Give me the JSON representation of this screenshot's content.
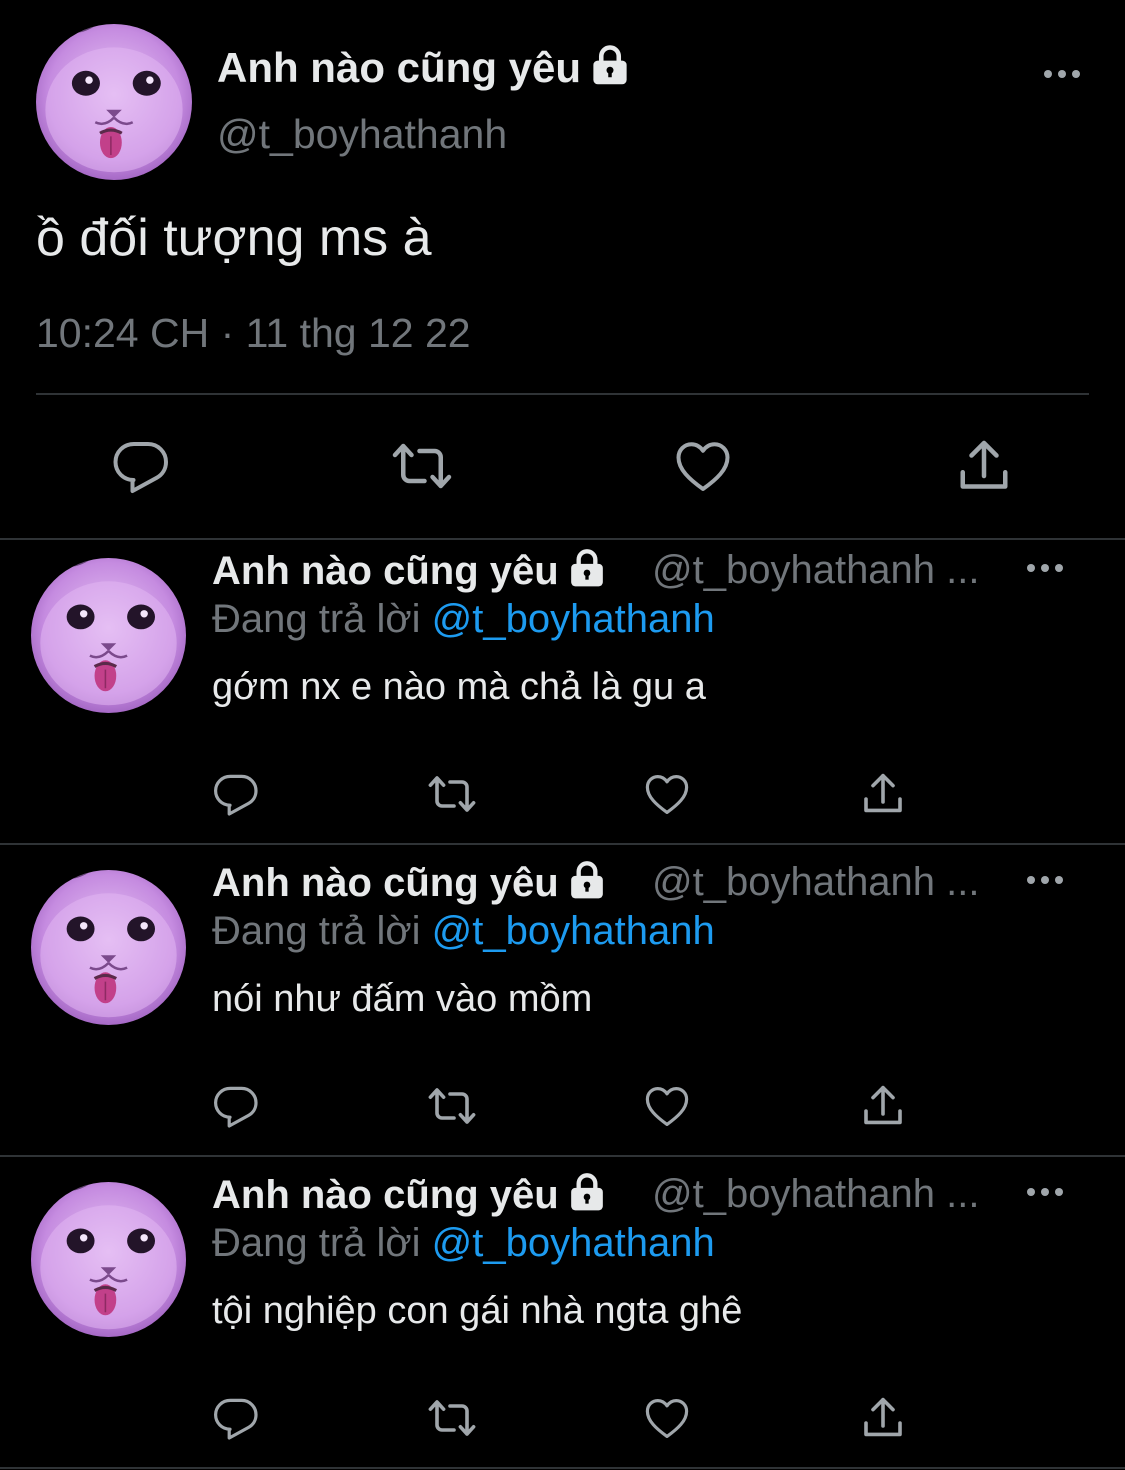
{
  "main_tweet": {
    "display_name": "Anh nào cũng yêu",
    "handle": "@t_boyhathanh",
    "text": "ồ đối tượng ms à",
    "timestamp": "10:24 CH · 11 thg 12 22"
  },
  "replies": [
    {
      "display_name": "Anh nào cũng yêu",
      "handle": "@t_boyhathanh ...",
      "replying_prefix": "Đang trả lời ",
      "replying_to": "@t_boyhathanh",
      "text": "gớm nx e nào mà chả là gu a"
    },
    {
      "display_name": "Anh nào cũng yêu",
      "handle": "@t_boyhathanh ...",
      "replying_prefix": "Đang trả lời ",
      "replying_to": "@t_boyhathanh",
      "text": "nói như đấm vào mồm"
    },
    {
      "display_name": "Anh nào cũng yêu",
      "handle": "@t_boyhathanh ...",
      "replying_prefix": "Đang trả lời ",
      "replying_to": "@t_boyhathanh",
      "text": "tội nghiệp con gái nhà ngta ghê"
    }
  ],
  "icons": {
    "reply": "reply-icon",
    "retweet": "retweet-icon",
    "like": "heart-icon",
    "share": "share-icon",
    "more": "more-icon",
    "lock": "lock-icon"
  },
  "colors": {
    "background": "#000000",
    "text": "#e7e9ea",
    "secondary": "#71767b",
    "link": "#1d9bf0",
    "avatar_tint": "#c58be0"
  }
}
